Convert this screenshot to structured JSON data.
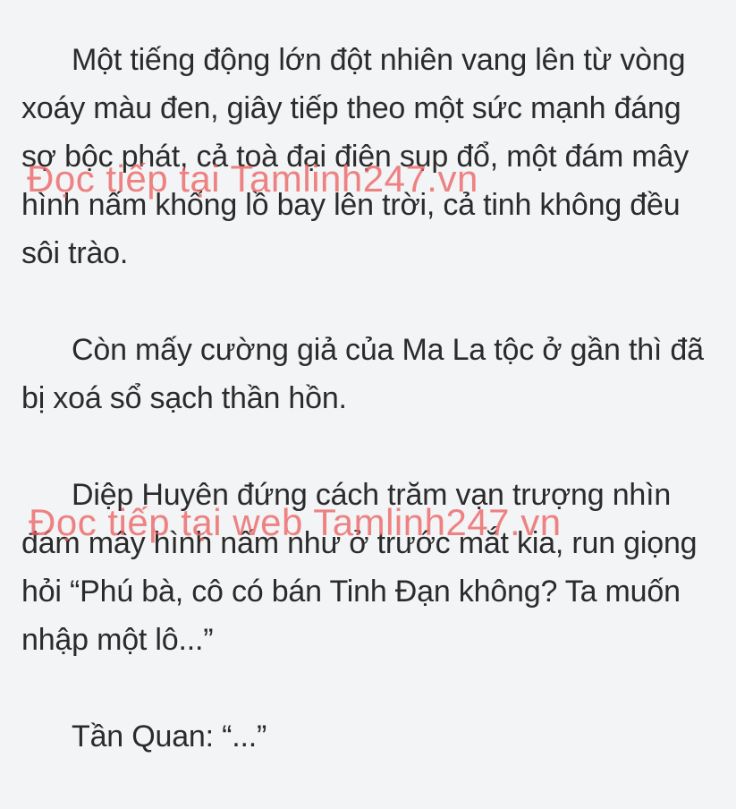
{
  "story": {
    "paragraphs": [
      "Một tiếng động lớn đột nhiên vang lên từ vòng xoáy màu đen, giây tiếp theo một sức mạnh đáng sợ bộc phát, cả toà đại điện sụp đổ, một đám mây hình nấm khổng lồ bay lên trời, cả tinh không đều sôi trào.",
      "Còn mấy cường giả của Ma La tộc ở gần thì đã bị xoá sổ sạch thần hồn.",
      "Diệp Huyên đứng cách trăm vạn trượng nhìn đám mây hình nấm như ở trước mắt kia, run giọng hỏi “Phú bà, cô có bán Tinh Đạn không? Ta muốn nhập một lô...”",
      "Tần Quan: “...”"
    ]
  },
  "watermarks": {
    "top": "Đọc tiếp tại Tamlinh247.vn",
    "middle": "Đọc tiếp tại web Tamlinh247.vn"
  },
  "colors": {
    "background": "#f3f4f6",
    "text": "#2b2b2b",
    "watermark": "#ec6060"
  }
}
